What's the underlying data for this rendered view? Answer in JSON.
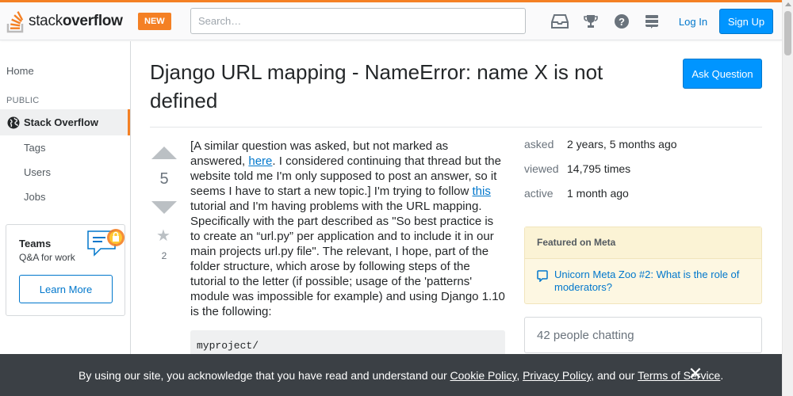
{
  "header": {
    "logo_prefix": "stack",
    "logo_suffix": "overflow",
    "new_badge": "NEW",
    "search_placeholder": "Search…",
    "login_label": "Log In",
    "signup_label": "Sign Up",
    "icons": [
      "inbox-icon",
      "trophy-icon",
      "help-icon",
      "stack-exchange-icon"
    ]
  },
  "sidebar": {
    "home": "Home",
    "public_label": "PUBLIC",
    "stack_overflow": "Stack Overflow",
    "items": [
      "Tags",
      "Users",
      "Jobs"
    ],
    "teams": {
      "title": "Teams",
      "subtitle": "Q&A for work",
      "button": "Learn More"
    }
  },
  "question": {
    "title": "Django URL mapping - NameError: name X is not defined",
    "ask_button": "Ask Question",
    "votes": "5",
    "favorites": "2",
    "body": {
      "p1": "[A similar question was asked, but not marked as answered, ",
      "link1": "here",
      "p2": ". I considered continuing that thread but the website told me I'm only supposed to post an answer, so it seems I have to start a new topic.] I'm trying to follow ",
      "link2": "this",
      "p3": " tutorial and I'm having problems with the URL mapping. Specifically with the part described as \"So best practice is to create an “url.py” per application and to include it in our main projects url.py file\". The relevant, I hope, part of the folder structure, which arose by following steps of the tutorial to the letter (if possible; usage of the 'patterns' module was impossible for example) and using Django 1.10 is the following:"
    },
    "code": "myproject/"
  },
  "stats": {
    "asked_label": "asked",
    "asked_value": "2 years, 5 months ago",
    "viewed_label": "viewed",
    "viewed_value": "14,795 times",
    "active_label": "active",
    "active_value": "1 month ago"
  },
  "meta": {
    "heading": "Featured on Meta",
    "item": "Unicorn Meta Zoo #2: What is the role of moderators?"
  },
  "chat": {
    "text": "42 people chatting"
  },
  "cookie": {
    "t1": "By using our site, you acknowledge that you have read and understand our ",
    "cookie_policy": "Cookie Policy",
    "sep": ", ",
    "privacy_policy": "Privacy Policy",
    "t2": ", and our ",
    "terms": "Terms of Service",
    "t3": ".",
    "close": "✕"
  },
  "colors": {
    "accent": "#f48024",
    "link": "#0077cc",
    "primary_button": "#0095ff",
    "banner": "#3b4045"
  }
}
